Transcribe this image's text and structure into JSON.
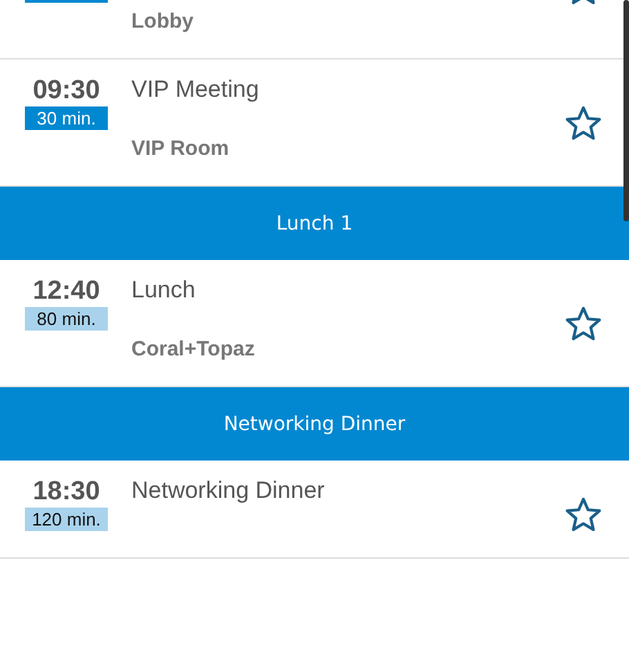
{
  "items": [
    {
      "kind": "session",
      "location": "Lobby",
      "color": "#0288d1",
      "starred": false,
      "cut": true
    },
    {
      "kind": "session",
      "time": "09:30",
      "duration": "30 min.",
      "color": "#0288d1",
      "title": "VIP Meeting",
      "location": "VIP Room",
      "starred": false,
      "cut": false
    },
    {
      "kind": "header",
      "label": "Lunch 1"
    },
    {
      "kind": "session",
      "time": "12:40",
      "duration": "80 min.",
      "color": "#a9d3ec",
      "title": "Lunch",
      "location": "Coral+Topaz",
      "starred": false,
      "cut": false
    },
    {
      "kind": "header",
      "label": "Networking Dinner"
    },
    {
      "kind": "session",
      "time": "18:30",
      "duration": "120 min.",
      "color": "#a9d3ec",
      "title": "Networking Dinner",
      "starred": false,
      "cut": false
    }
  ]
}
